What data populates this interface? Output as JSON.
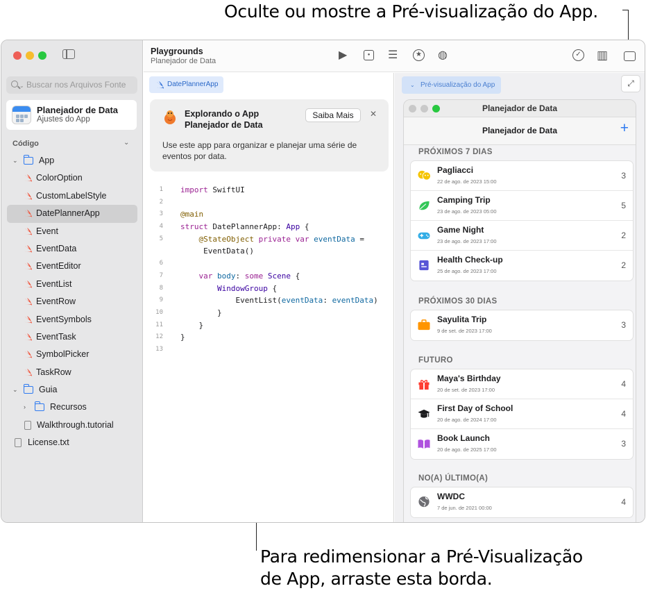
{
  "callouts": {
    "top": "Oculte ou mostre a Pré-visualização do App.",
    "bottom_line1": "Para redimensionar a Pré-Visualização",
    "bottom_line2": "de App, arraste esta borda."
  },
  "colors": {
    "accent": "#2f7bf0",
    "swift": "#f05138",
    "traffic_red": "#ee5f57",
    "traffic_yellow": "#f6bd2f",
    "traffic_green": "#28c840"
  },
  "sidebar": {
    "search_placeholder": "Buscar nos Arquivos Fonte",
    "project_title": "Planejador de Data",
    "project_subtitle": "Ajustes do App",
    "section": "Código",
    "items": [
      {
        "label": "App",
        "type": "folder",
        "level": 0,
        "open": true
      },
      {
        "label": "ColorOption",
        "type": "swift",
        "level": 1
      },
      {
        "label": "CustomLabelStyle",
        "type": "swift",
        "level": 1
      },
      {
        "label": "DatePlannerApp",
        "type": "swift",
        "level": 1,
        "selected": true
      },
      {
        "label": "Event",
        "type": "swift",
        "level": 1
      },
      {
        "label": "EventData",
        "type": "swift",
        "level": 1
      },
      {
        "label": "EventEditor",
        "type": "swift",
        "level": 1
      },
      {
        "label": "EventList",
        "type": "swift",
        "level": 1
      },
      {
        "label": "EventRow",
        "type": "swift",
        "level": 1
      },
      {
        "label": "EventSymbols",
        "type": "swift",
        "level": 1
      },
      {
        "label": "EventTask",
        "type": "swift",
        "level": 1
      },
      {
        "label": "SymbolPicker",
        "type": "swift",
        "level": 1
      },
      {
        "label": "TaskRow",
        "type": "swift",
        "level": 1
      },
      {
        "label": "Guia",
        "type": "folder",
        "level": 0,
        "open": true
      },
      {
        "label": "Recursos",
        "type": "folder",
        "level": 1,
        "open": false
      },
      {
        "label": "Walkthrough.tutorial",
        "type": "doc",
        "level": 1
      },
      {
        "label": "License.txt",
        "type": "doc",
        "level": 0
      }
    ]
  },
  "toolbar": {
    "title": "Playgrounds",
    "subtitle": "Planejador de Data",
    "icons": [
      "play-icon",
      "record-icon",
      "sliders-icon",
      "star-icon",
      "palette-icon",
      "checkmark-icon",
      "library-icon",
      "preview-toggle-icon"
    ]
  },
  "editor": {
    "tab": "DatePlannerApp",
    "card": {
      "title": "Explorando o App Planejador de Data",
      "button": "Saiba Mais",
      "description": "Use este app para organizar e planejar uma série de eventos por data."
    },
    "code": [
      {
        "n": "1",
        "text": "import SwiftUI"
      },
      {
        "n": "2",
        "text": ""
      },
      {
        "n": "3",
        "text": "@main"
      },
      {
        "n": "4",
        "text": "struct DatePlannerApp: App {"
      },
      {
        "n": "5",
        "text": "    @StateObject private var eventData ="
      },
      {
        "n": "",
        "text": "     EventData()"
      },
      {
        "n": "6",
        "text": ""
      },
      {
        "n": "7",
        "text": "    var body: some Scene {"
      },
      {
        "n": "8",
        "text": "        WindowGroup {"
      },
      {
        "n": "9",
        "text": "            EventList(eventData: eventData)"
      },
      {
        "n": "10",
        "text": "        }"
      },
      {
        "n": "11",
        "text": "    }"
      },
      {
        "n": "12",
        "text": "}"
      },
      {
        "n": "13",
        "text": ""
      }
    ]
  },
  "preview": {
    "tab": "Pré-visualização do App",
    "window_title": "Planejador de Data",
    "nav_title": "Planejador de Data",
    "add_label": "+",
    "sections": [
      {
        "header": "PRÓXIMOS 7 DIAS",
        "events": [
          {
            "title": "Pagliacci",
            "date": "22 de ago. de 2023 15:00",
            "count": "3",
            "icon": "theater-masks-icon",
            "color": "#f5c400"
          },
          {
            "title": "Camping Trip",
            "date": "23 de ago. de 2023 05:00",
            "count": "5",
            "icon": "leaf-icon",
            "color": "#34c759"
          },
          {
            "title": "Game Night",
            "date": "23 de ago. de 2023 17:00",
            "count": "2",
            "icon": "gamecontroller-icon",
            "color": "#32ade6"
          },
          {
            "title": "Health Check-up",
            "date": "25 de ago. de 2023 17:00",
            "count": "2",
            "icon": "medical-card-icon",
            "color": "#5856d6"
          }
        ]
      },
      {
        "header": "PRÓXIMOS 30 DIAS",
        "events": [
          {
            "title": "Sayulita Trip",
            "date": "9 de set. de 2023 17:00",
            "count": "3",
            "icon": "suitcase-icon",
            "color": "#ff9500"
          }
        ]
      },
      {
        "header": "FUTURO",
        "events": [
          {
            "title": "Maya's Birthday",
            "date": "20 de set. de 2023 17:00",
            "count": "4",
            "icon": "gift-icon",
            "color": "#ff3b30"
          },
          {
            "title": "First Day of School",
            "date": "20 de ago. de 2024 17:00",
            "count": "4",
            "icon": "graduationcap-icon",
            "color": "#1d1d1f"
          },
          {
            "title": "Book Launch",
            "date": "20 de ago. de 2025 17:00",
            "count": "3",
            "icon": "book-icon",
            "color": "#af52de"
          }
        ]
      },
      {
        "header": "NO(A) ÚLTIMO(A)",
        "events": [
          {
            "title": "WWDC",
            "date": "7 de jun. de 2021 00:00",
            "count": "4",
            "icon": "globe-icon",
            "color": "#6e6e73"
          }
        ]
      }
    ]
  }
}
